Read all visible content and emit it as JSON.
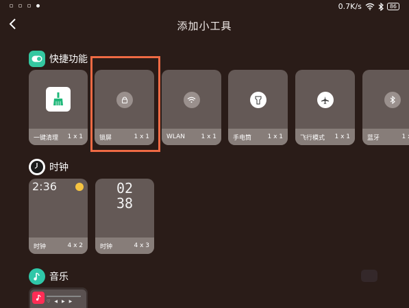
{
  "status_bar": {
    "speed": "0.7K/s",
    "battery": "86",
    "icons": [
      "notification-dot-icon",
      "wifi-icon",
      "bluetooth-icon",
      "battery-icon"
    ]
  },
  "header": {
    "title": "添加小工具",
    "back_icon": "back-arrow-icon"
  },
  "sections": {
    "quick": {
      "title": "快捷功能",
      "icon_color": "#34c7a0",
      "tiles": [
        {
          "name": "一键清理",
          "size": "1 x 1",
          "icon": "broom-icon"
        },
        {
          "name": "锁屏",
          "size": "1 x 1",
          "icon": "lock-icon"
        },
        {
          "name": "WLAN",
          "size": "1 x 1",
          "icon": "wifi-icon"
        },
        {
          "name": "手电筒",
          "size": "1 x 1",
          "icon": "flashlight-icon"
        },
        {
          "name": "飞行模式",
          "size": "1 x 1",
          "icon": "airplane-icon"
        },
        {
          "name": "蓝牙",
          "size": "1 x 1",
          "icon": "bluetooth-icon"
        }
      ]
    },
    "clock": {
      "title": "时钟",
      "widgets": [
        {
          "name": "时钟",
          "size": "4 x 2",
          "time": "2:36"
        },
        {
          "name": "时钟",
          "size": "4 x 3",
          "hour": "02",
          "minute": "38"
        }
      ]
    },
    "music": {
      "title": "音乐",
      "icon_color": "#2fc7a8"
    }
  },
  "colors": {
    "background": "#2a1c18",
    "card": "#645956",
    "card_label": "#877d79",
    "highlight": "#ef6a44"
  }
}
